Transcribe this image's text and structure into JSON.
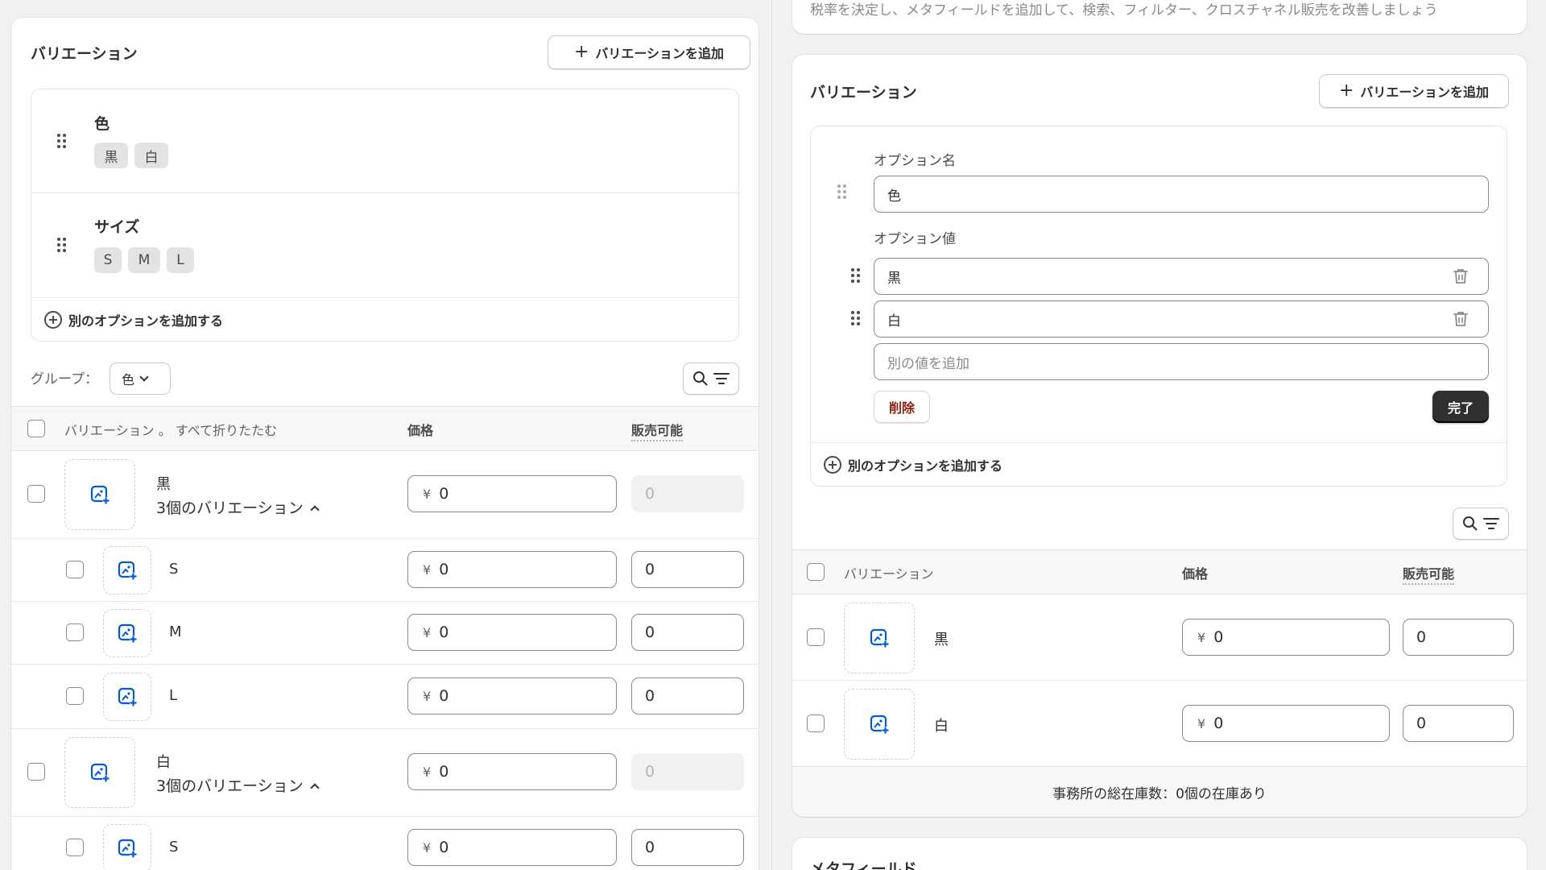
{
  "top_partial_text": "税率を決定し、メタフィールドを追加して、検索、フィルター、クロスチャネル販売を改善しましょう",
  "left": {
    "title": "バリエーション",
    "add_variant_label": "バリエーションを追加",
    "options": [
      {
        "name": "色",
        "values": [
          "黒",
          "白"
        ]
      },
      {
        "name": "サイズ",
        "values": [
          "S",
          "M",
          "L"
        ]
      }
    ],
    "add_option_label": "別のオプションを追加する",
    "group_label": "グループ：",
    "group_value": "色",
    "columns": {
      "variant": "バリエーション 。 すべて折りたたむ",
      "price": "価格",
      "available": "販売可能"
    },
    "groups": [
      {
        "name": "黒",
        "sub": "3個のバリエーション",
        "currency": "¥",
        "price": "0",
        "qty": "0",
        "children": [
          {
            "name": "S",
            "currency": "¥",
            "price": "0",
            "qty": "0"
          },
          {
            "name": "M",
            "currency": "¥",
            "price": "0",
            "qty": "0"
          },
          {
            "name": "L",
            "currency": "¥",
            "price": "0",
            "qty": "0"
          }
        ]
      },
      {
        "name": "白",
        "sub": "3個のバリエーション",
        "currency": "¥",
        "price": "0",
        "qty": "0",
        "children": [
          {
            "name": "S",
            "currency": "¥",
            "price": "0",
            "qty": "0"
          }
        ]
      }
    ]
  },
  "right": {
    "title": "バリエーション",
    "add_variant_label": "バリエーションを追加",
    "option_name_label": "オプション名",
    "option_name_value": "色",
    "option_values_label": "オプション値",
    "option_values": [
      "黒",
      "白"
    ],
    "add_value_placeholder": "別の値を追加",
    "delete_label": "削除",
    "done_label": "完了",
    "add_option_label": "別のオプションを追加する",
    "columns": {
      "variant": "バリエーション",
      "price": "価格",
      "available": "販売可能"
    },
    "rows": [
      {
        "name": "黒",
        "currency": "¥",
        "price": "0",
        "qty": "0"
      },
      {
        "name": "白",
        "currency": "¥",
        "price": "0",
        "qty": "0"
      }
    ],
    "summary": "事務所の総在庫数：0個の在庫あり",
    "next_card_title": "メタフィールド"
  },
  "colors": {
    "accent_icon": "#005bd3",
    "delete_text": "#8e1f0b",
    "done_bg": "#303030"
  }
}
